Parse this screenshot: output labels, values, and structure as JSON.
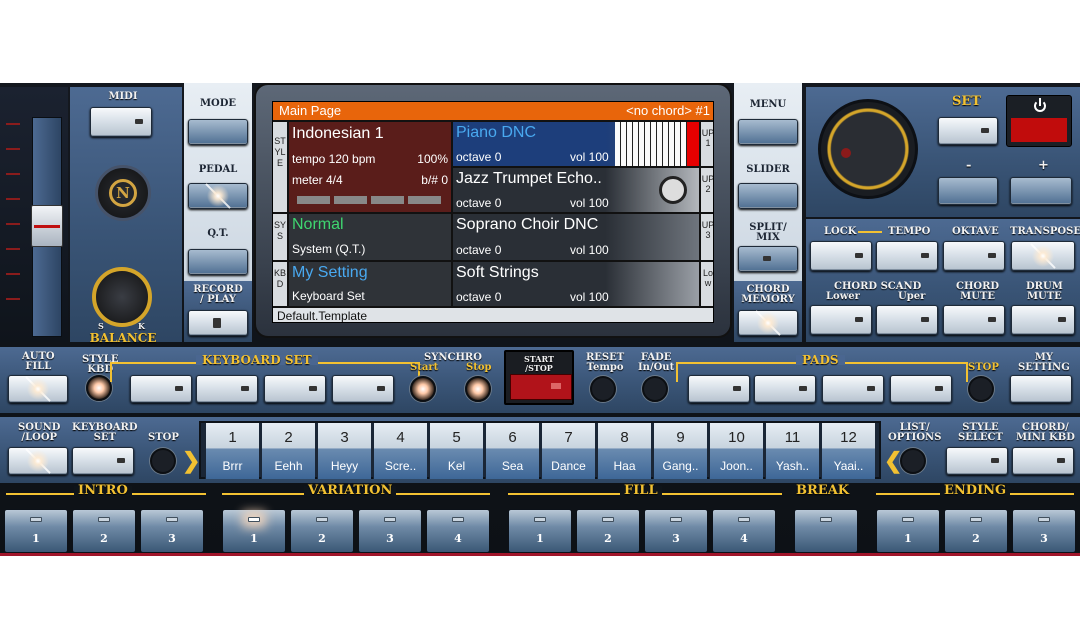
{
  "colors": {
    "accent_gold": "#f2c132",
    "lcd_title": "#e8650b",
    "power_red": "#c10c0c"
  },
  "left": {
    "midi_label": "MIDI",
    "balance_label": "BALANCE",
    "slider_s": "S",
    "slider_k": "K"
  },
  "modes": {
    "mode": "MODE",
    "pedal": "PEDAL",
    "qt": "Q.T.",
    "record": "RECORD\n/ PLAY"
  },
  "right_modes": {
    "menu": "MENU",
    "slider": "SLIDER",
    "split": "SPLIT/\nMIX",
    "chord_memory": "CHORD\nMEMORY"
  },
  "screen": {
    "title": "Main Page",
    "chord": "<no chord> #1",
    "style_side": "STYLE",
    "sys_side": "SYS",
    "kbd_side": "KBD",
    "style_name": "Indonesian 1",
    "tempo": "tempo 120 bpm",
    "tempo_pct": "100%",
    "meter": "meter 4/4",
    "bsharp": "b/# 0",
    "normal": "Normal",
    "system": "System (Q.T.)",
    "my_setting": "My Setting",
    "keyboard_set": "Keyboard Set",
    "template": "Default.Template",
    "voices": [
      {
        "name": "Piano DNC",
        "octave": "octave 0",
        "vol": "vol 100",
        "side": "UP1"
      },
      {
        "name": "Jazz Trumpet Echo..",
        "octave": "octave 0",
        "vol": "vol 100",
        "side": "UP2"
      },
      {
        "name": "Soprano Choir DNC",
        "octave": "octave 0",
        "vol": "vol 100",
        "side": "UP3"
      },
      {
        "name": "Soft Strings",
        "octave": "octave 0",
        "vol": "vol 100",
        "side": "Low"
      }
    ]
  },
  "right": {
    "set": "SET",
    "minus": "-",
    "plus": "+",
    "lock": "LOCK",
    "tempo": "TEMPO",
    "oktave": "OKTAVE",
    "transpose": "TRANSPOSE",
    "chord_scand": "CHORD SCAND",
    "lower": "Lower",
    "uper": "Uper",
    "chord_mute": "CHORD\nMUTE",
    "drum_mute": "DRUM\nMUTE"
  },
  "row2": {
    "auto_fill": "AUTO\nFILL",
    "style_kbd": "STYLE\nKBD",
    "keyboard_set": "KEYBOARD SET",
    "synchro": "SYNCHRO",
    "start": "Start",
    "stop": "Stop",
    "start_stop": "START\n/STOP",
    "reset_tempo": "RESET\nTempo",
    "fade": "FADE\nIn/Out",
    "pads": "PADS",
    "pads_stop": "STOP",
    "my_setting": "MY\nSETTING"
  },
  "row3": {
    "sound_loop": "SOUND\n/LOOP",
    "keyboard_set": "KEYBOARD\nSET",
    "stop": "STOP",
    "list_options": "LIST/\nOPTIONS",
    "style_select": "STYLE\nSELECT",
    "chord_mini": "CHORD/\nMINI KBD",
    "styles": [
      {
        "num": "1",
        "name": "Brrr"
      },
      {
        "num": "2",
        "name": "Eehh"
      },
      {
        "num": "3",
        "name": "Heyy"
      },
      {
        "num": "4",
        "name": "Scre.."
      },
      {
        "num": "5",
        "name": "Kel"
      },
      {
        "num": "6",
        "name": "Sea"
      },
      {
        "num": "7",
        "name": "Dance"
      },
      {
        "num": "8",
        "name": "Haa"
      },
      {
        "num": "9",
        "name": "Gang.."
      },
      {
        "num": "10",
        "name": "Joon.."
      },
      {
        "num": "11",
        "name": "Yash.."
      },
      {
        "num": "12",
        "name": "Yaai.."
      }
    ]
  },
  "bottom": {
    "intro": "INTRO",
    "variation": "VARIATION",
    "fill": "FILL",
    "break": "BREAK",
    "ending": "ENDING",
    "intro_btns": [
      "1",
      "2",
      "3"
    ],
    "variation_btns": [
      "1",
      "2",
      "3",
      "4"
    ],
    "fill_btns": [
      "1",
      "2",
      "3",
      "4"
    ],
    "ending_btns": [
      "1",
      "2",
      "3"
    ]
  }
}
